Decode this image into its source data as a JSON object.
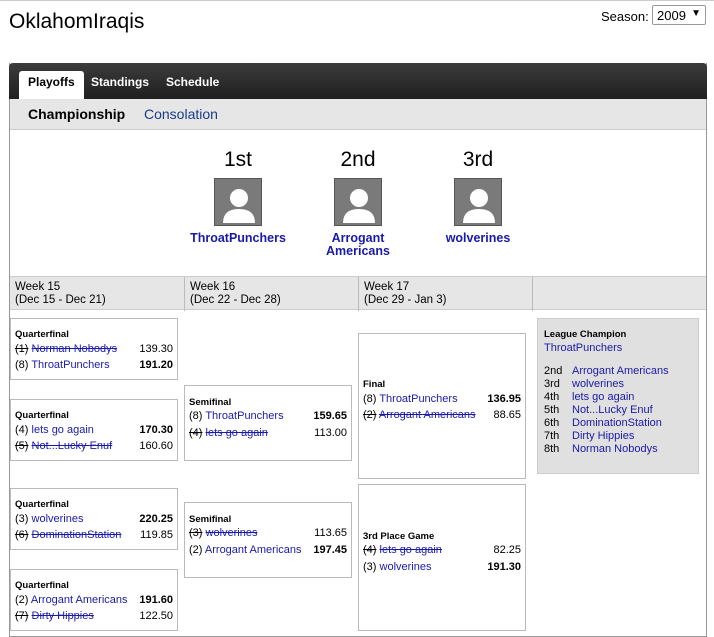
{
  "league": {
    "title": "OklahomIraqis"
  },
  "season": {
    "label": "Season:",
    "value": "2009"
  },
  "nav": {
    "tabs": [
      "Playoffs",
      "Standings",
      "Schedule"
    ]
  },
  "subnav": {
    "tabs": [
      "Championship",
      "Consolation"
    ]
  },
  "podium": [
    {
      "place": "1st",
      "team": "ThroatPunchers"
    },
    {
      "place": "2nd",
      "team": "Arrogant Americans"
    },
    {
      "place": "3rd",
      "team": "wolverines"
    }
  ],
  "weeks": [
    {
      "name": "Week 15",
      "range": "(Dec 15 - Dec 21)"
    },
    {
      "name": "Week 16",
      "range": "(Dec 22 - Dec 28)"
    },
    {
      "name": "Week 17",
      "range": "(Dec 29 - Jan 3)"
    }
  ],
  "matches": [
    {
      "label": "Quarterfinal",
      "rows": [
        {
          "seed": "(1)",
          "team": "Norman Nobodys",
          "score": "139.30",
          "result": "loser"
        },
        {
          "seed": "(8)",
          "team": "ThroatPunchers",
          "score": "191.20",
          "result": "winner"
        }
      ]
    },
    {
      "label": "Quarterfinal",
      "rows": [
        {
          "seed": "(4)",
          "team": "lets go again",
          "score": "170.30",
          "result": "winner"
        },
        {
          "seed": "(5)",
          "team": "Not...Lucky Enuf",
          "score": "160.60",
          "result": "loser"
        }
      ]
    },
    {
      "label": "Quarterfinal",
      "rows": [
        {
          "seed": "(3)",
          "team": "wolverines",
          "score": "220.25",
          "result": "winner"
        },
        {
          "seed": "(6)",
          "team": "DominationStation",
          "score": "119.85",
          "result": "loser"
        }
      ]
    },
    {
      "label": "Quarterfinal",
      "rows": [
        {
          "seed": "(2)",
          "team": "Arrogant Americans",
          "score": "191.60",
          "result": "winner"
        },
        {
          "seed": "(7)",
          "team": "Dirty Hippies",
          "score": "122.50",
          "result": "loser"
        }
      ]
    },
    {
      "label": "Semifinal",
      "rows": [
        {
          "seed": "(8)",
          "team": "ThroatPunchers",
          "score": "159.65",
          "result": "winner"
        },
        {
          "seed": "(4)",
          "team": "lets go again",
          "score": "113.00",
          "result": "loser"
        }
      ]
    },
    {
      "label": "Semifinal",
      "rows": [
        {
          "seed": "(3)",
          "team": "wolverines",
          "score": "113.65",
          "result": "loser"
        },
        {
          "seed": "(2)",
          "team": "Arrogant Americans",
          "score": "197.45",
          "result": "winner"
        }
      ]
    },
    {
      "label": "Final",
      "rows": [
        {
          "seed": "(8)",
          "team": "ThroatPunchers",
          "score": "136.95",
          "result": "winner"
        },
        {
          "seed": "(2)",
          "team": "Arrogant Americans",
          "score": "88.65",
          "result": "loser"
        }
      ]
    },
    {
      "label": "3rd Place Game",
      "rows": [
        {
          "seed": "(4)",
          "team": "lets go again",
          "score": "82.25",
          "result": "loser"
        },
        {
          "seed": "(3)",
          "team": "wolverines",
          "score": "191.30",
          "result": "winner"
        }
      ]
    }
  ],
  "champion": {
    "header": "League Champion",
    "team": "ThroatPunchers",
    "standings": [
      {
        "place": "2nd",
        "team": "Arrogant Americans"
      },
      {
        "place": "3rd",
        "team": "wolverines"
      },
      {
        "place": "4th",
        "team": "lets go again"
      },
      {
        "place": "5th",
        "team": "Not...Lucky Enuf"
      },
      {
        "place": "6th",
        "team": "DominationStation"
      },
      {
        "place": "7th",
        "team": "Dirty Hippies"
      },
      {
        "place": "8th",
        "team": "Norman Nobodys"
      }
    ]
  }
}
